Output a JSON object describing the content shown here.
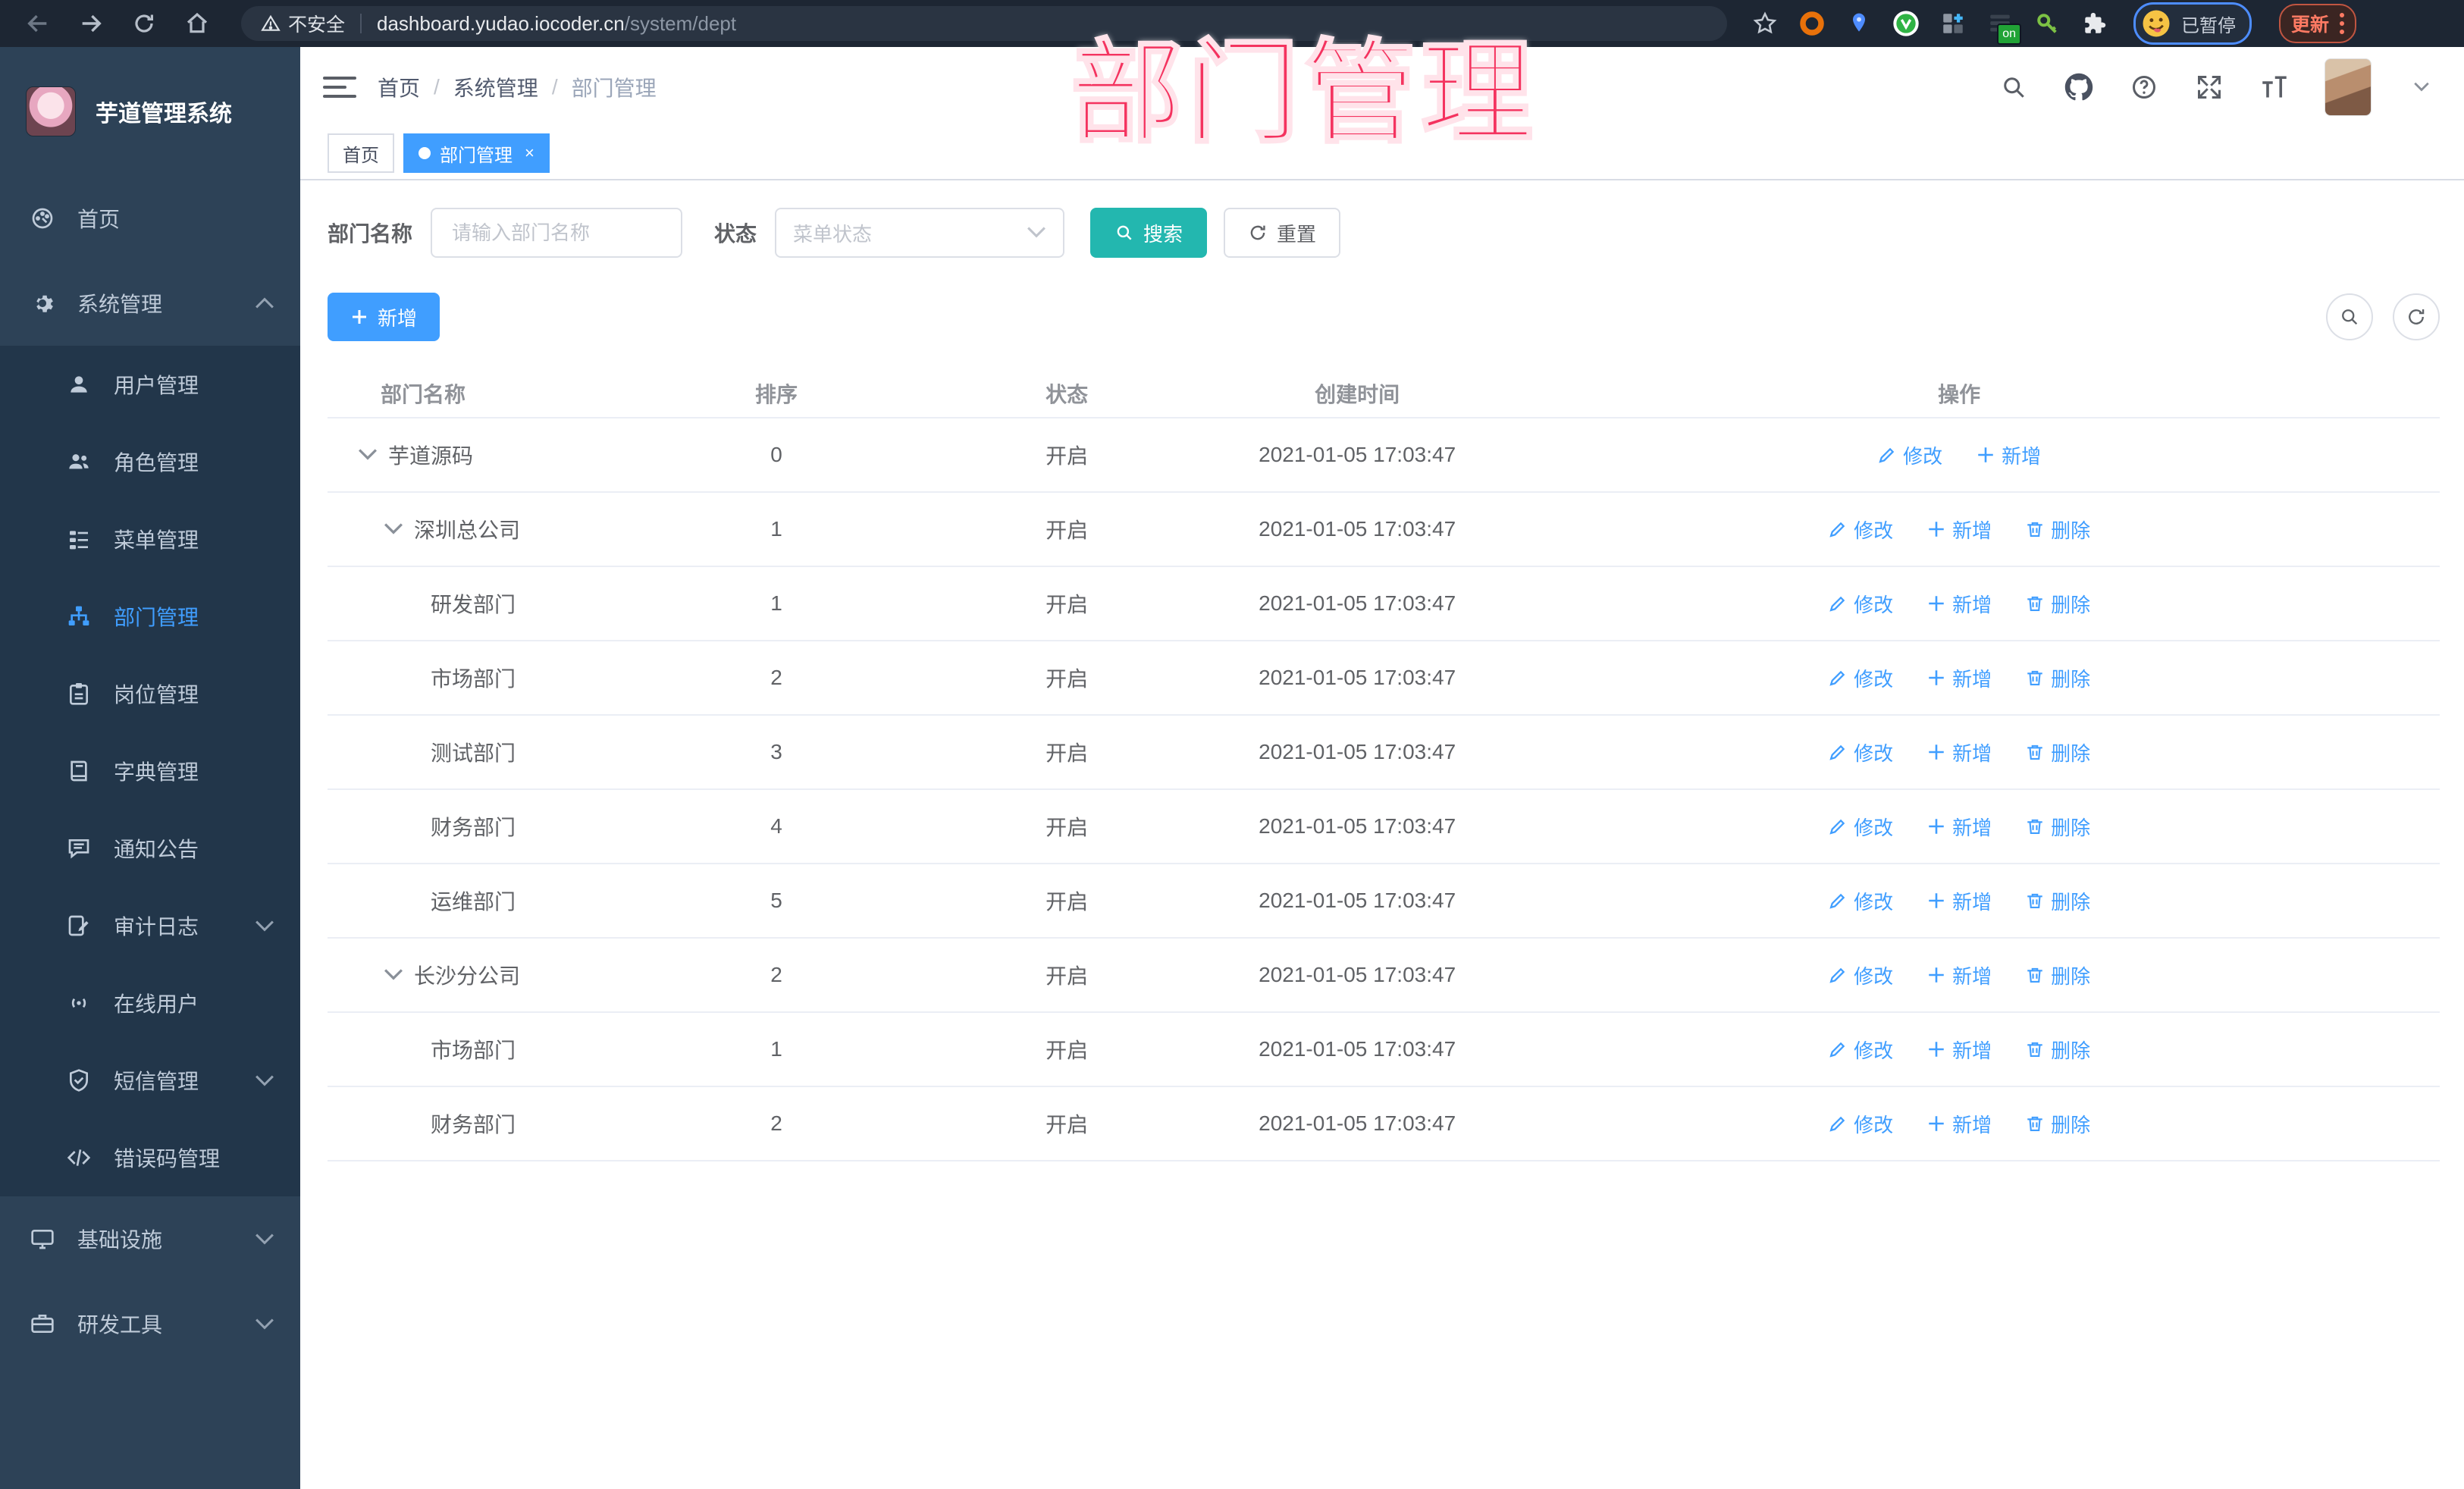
{
  "browser": {
    "security_label": "不安全",
    "url_host": "dashboard.yudao.iocoder.cn",
    "url_path": "/system/dept",
    "extension_badge": "on",
    "profile_chip": "已暂停",
    "update_button": "更新"
  },
  "watermark": "部门管理",
  "sidebar": {
    "title": "芋道管理系统",
    "top_items": [
      "首页",
      "系统管理"
    ],
    "sub_items": [
      "用户管理",
      "角色管理",
      "菜单管理",
      "部门管理",
      "岗位管理",
      "字典管理",
      "通知公告",
      "审计日志",
      "在线用户",
      "短信管理",
      "错误码管理"
    ],
    "bottom_items": [
      "基础设施",
      "研发工具"
    ]
  },
  "breadcrumb": [
    "首页",
    "系统管理",
    "部门管理"
  ],
  "tabs": {
    "home": "首页",
    "current": "部门管理"
  },
  "filters": {
    "name_label": "部门名称",
    "name_placeholder": "请输入部门名称",
    "status_label": "状态",
    "status_placeholder": "菜单状态",
    "search": "搜索",
    "reset": "重置"
  },
  "toolbar": {
    "add": "新增"
  },
  "table": {
    "columns": [
      "部门名称",
      "排序",
      "状态",
      "创建时间",
      "操作"
    ],
    "action_labels": {
      "edit": "修改",
      "add": "新增",
      "delete": "删除"
    },
    "rows": [
      {
        "name": "芋道源码",
        "sort": "0",
        "status": "开启",
        "created": "2021-01-05 17:03:47"
      },
      {
        "name": "深圳总公司",
        "sort": "1",
        "status": "开启",
        "created": "2021-01-05 17:03:47"
      },
      {
        "name": "研发部门",
        "sort": "1",
        "status": "开启",
        "created": "2021-01-05 17:03:47"
      },
      {
        "name": "市场部门",
        "sort": "2",
        "status": "开启",
        "created": "2021-01-05 17:03:47"
      },
      {
        "name": "测试部门",
        "sort": "3",
        "status": "开启",
        "created": "2021-01-05 17:03:47"
      },
      {
        "name": "财务部门",
        "sort": "4",
        "status": "开启",
        "created": "2021-01-05 17:03:47"
      },
      {
        "name": "运维部门",
        "sort": "5",
        "status": "开启",
        "created": "2021-01-05 17:03:47"
      },
      {
        "name": "长沙分公司",
        "sort": "2",
        "status": "开启",
        "created": "2021-01-05 17:03:47"
      },
      {
        "name": "市场部门",
        "sort": "1",
        "status": "开启",
        "created": "2021-01-05 17:03:47"
      },
      {
        "name": "财务部门",
        "sort": "2",
        "status": "开启",
        "created": "2021-01-05 17:03:47"
      }
    ]
  },
  "colors": {
    "accent": "#409eff",
    "search_teal": "#23b7af",
    "watermark_pink": "#f4335f",
    "sidebar_bg": "#2d4257",
    "submenu_bg": "#22364a"
  }
}
